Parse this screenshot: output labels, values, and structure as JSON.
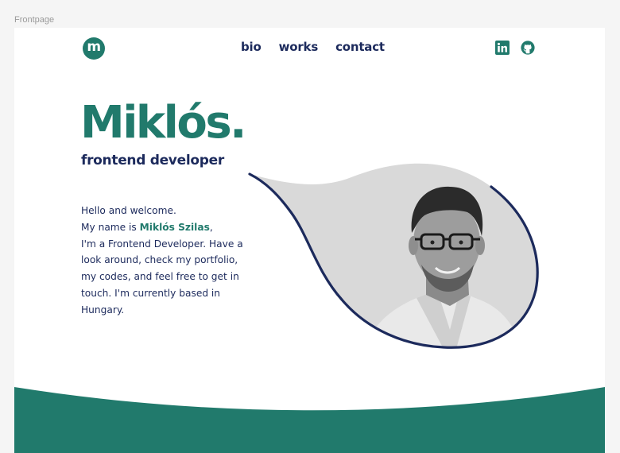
{
  "frame_label": "Frontpage",
  "logo": {
    "letter": "m"
  },
  "nav": {
    "bio": "bio",
    "works": "works",
    "contact": "contact"
  },
  "socials": {
    "linkedin_icon": "linkedin-icon",
    "github_icon": "github-icon"
  },
  "hero": {
    "name": "Miklós.",
    "role": "frontend developer"
  },
  "intro": {
    "line1": "Hello and welcome.",
    "name_prefix": "My name is ",
    "name": "Miklós Szilas",
    "name_suffix": ",",
    "body": "I'm a Frontend Developer. Have a look around, check my portfolio, my codes, and feel free to get in touch. I'm currently based in Hungary."
  },
  "colors": {
    "accent": "#217a6c",
    "navy": "#1c2a5c",
    "blob_fill": "#d9d9d9"
  }
}
